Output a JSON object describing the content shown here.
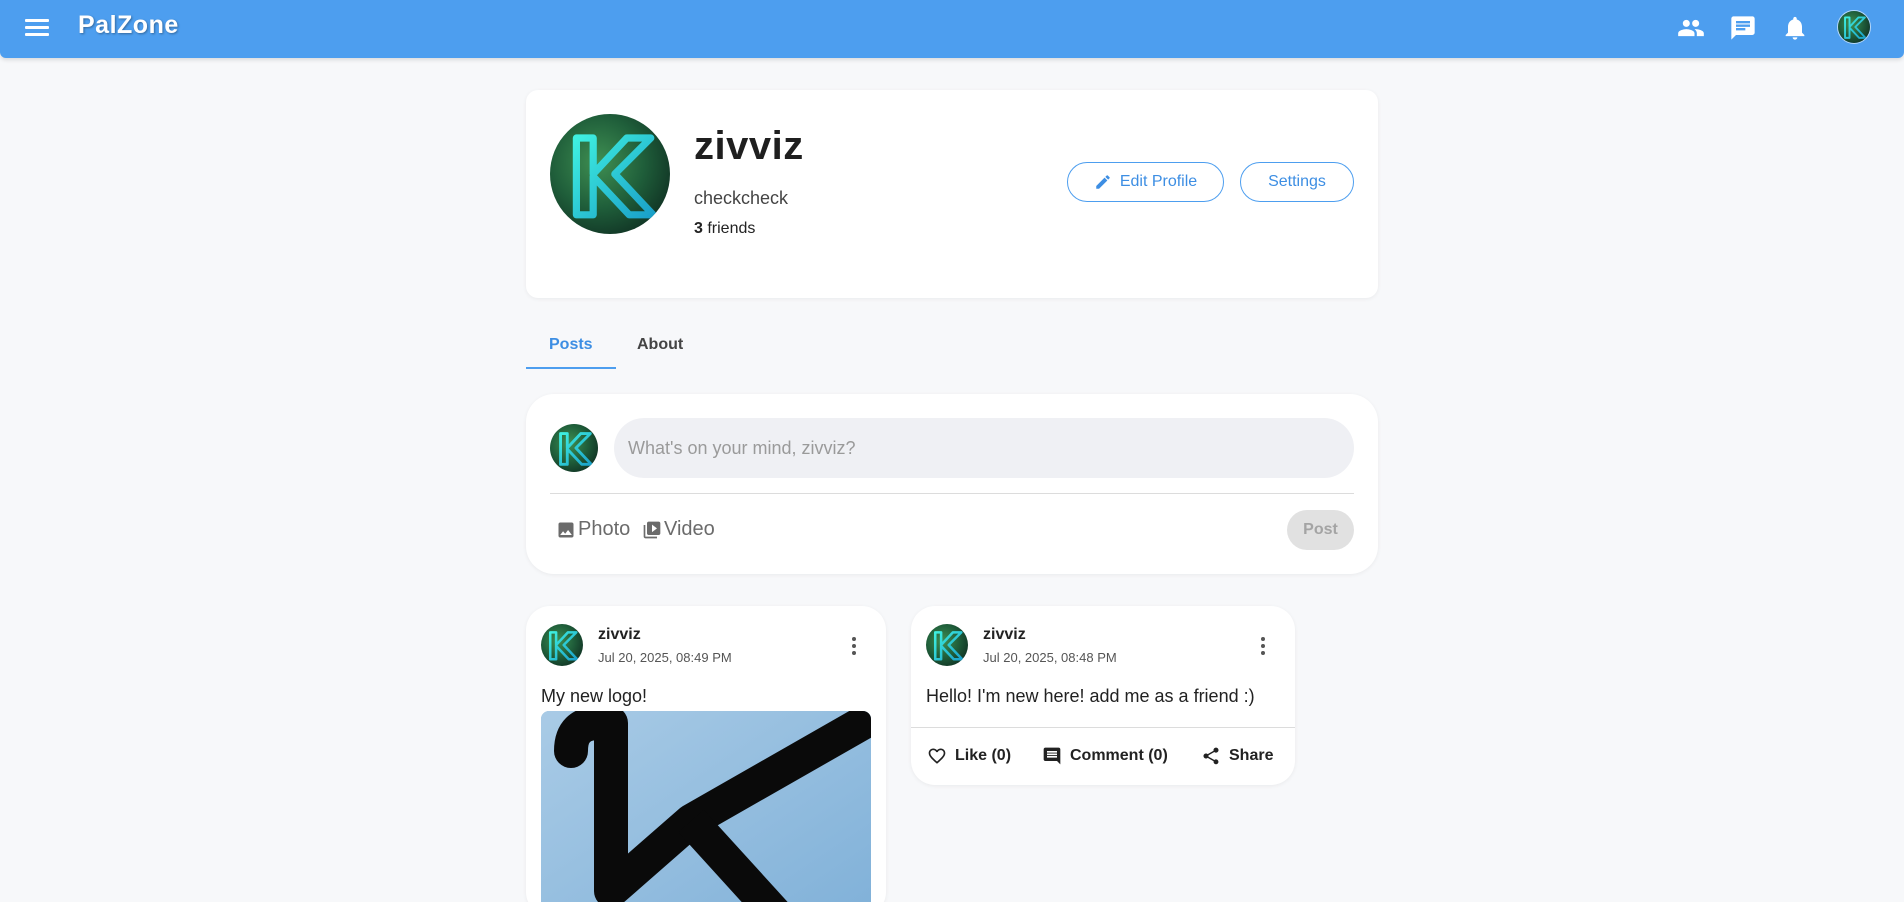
{
  "app": {
    "brand": "PalZone"
  },
  "header": {
    "icons": [
      "menu-icon",
      "people-icon",
      "chat-icon",
      "bell-icon",
      "avatar"
    ],
    "accent_color": "#4d9eef"
  },
  "profile": {
    "name": "zivviz",
    "bio": "checkcheck",
    "friends_count": "3",
    "friends_label": " friends",
    "edit_profile_label": "Edit Profile",
    "settings_label": "Settings"
  },
  "tabs": [
    {
      "label": "Posts",
      "active": true
    },
    {
      "label": "About",
      "active": false
    }
  ],
  "composer": {
    "placeholder": "What's on your mind, zivviz?",
    "photo_label": "Photo",
    "video_label": "Video",
    "post_label": "Post"
  },
  "posts": [
    {
      "author": "zivviz",
      "time": "Jul 20, 2025, 08:49 PM",
      "text": "My new logo!",
      "has_image": true
    },
    {
      "author": "zivviz",
      "time": "Jul 20, 2025, 08:48 PM",
      "text": "Hello! I'm new here! add me as a friend :)",
      "like_label": "Like (0)",
      "comment_label": "Comment (0)",
      "share_label": "Share"
    }
  ]
}
